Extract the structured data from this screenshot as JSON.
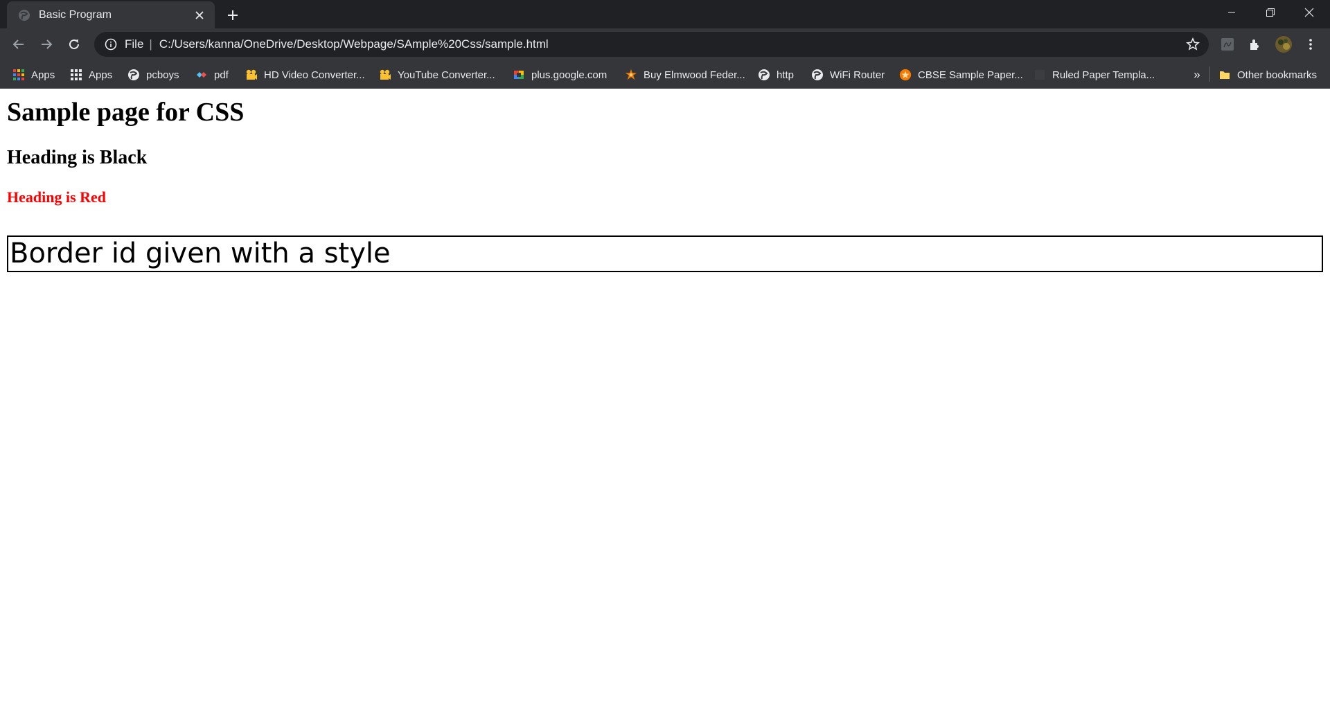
{
  "colors": {
    "tabstrip_bg": "#202124",
    "toolbar_bg": "#35363a",
    "red_heading": "#ff0000"
  },
  "tab": {
    "title": "Basic Program",
    "favicon": "globe-icon"
  },
  "omnibox": {
    "scheme": "File",
    "url": "C:/Users/kanna/OneDrive/Desktop/Webpage/SAmple%20Css/sample.html"
  },
  "bookmarks": {
    "items": [
      {
        "label": "Apps",
        "icon": "apps-color-grid-icon"
      },
      {
        "label": "Apps",
        "icon": "apps-grid-icon"
      },
      {
        "label": "pcboys",
        "icon": "globe-icon"
      },
      {
        "label": "pdf",
        "icon": "pdf-icon"
      },
      {
        "label": "HD Video Converter...",
        "icon": "film-icon"
      },
      {
        "label": "YouTube Converter...",
        "icon": "film-icon"
      },
      {
        "label": "plus.google.com",
        "icon": "google-plus-icon"
      },
      {
        "label": "Buy Elmwood Feder...",
        "icon": "flower-icon"
      },
      {
        "label": "http",
        "icon": "globe-icon"
      },
      {
        "label": "WiFi Router",
        "icon": "globe-icon"
      },
      {
        "label": "CBSE Sample Paper...",
        "icon": "orange-badge-icon"
      },
      {
        "label": "Ruled Paper Templa...",
        "icon": "blank-icon"
      }
    ],
    "more": "»",
    "other": "Other bookmarks"
  },
  "page": {
    "h1": "Sample page for CSS",
    "h2": "Heading is Black",
    "h3": "Heading is Red",
    "boxed_text": "Border id given with a style"
  }
}
